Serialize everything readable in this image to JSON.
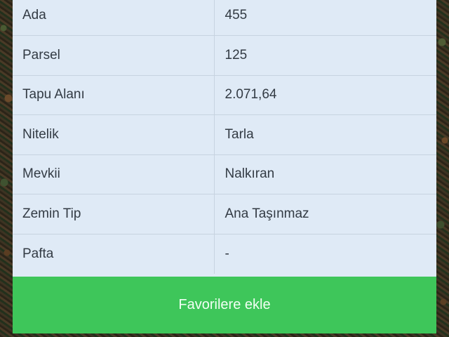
{
  "details": {
    "rows": [
      {
        "label": "Ada",
        "value": "455"
      },
      {
        "label": "Parsel",
        "value": "125"
      },
      {
        "label": "Tapu Alanı",
        "value": "2.071,64"
      },
      {
        "label": "Nitelik",
        "value": "Tarla"
      },
      {
        "label": "Mevkii",
        "value": "Nalkıran"
      },
      {
        "label": "Zemin Tip",
        "value": "Ana Taşınmaz"
      },
      {
        "label": "Pafta",
        "value": "-"
      }
    ]
  },
  "actions": {
    "favorite_label": "Favorilere ekle"
  },
  "colors": {
    "panel_bg": "#dfeaf6",
    "button_bg": "#3ec65a",
    "text": "#333b44"
  }
}
